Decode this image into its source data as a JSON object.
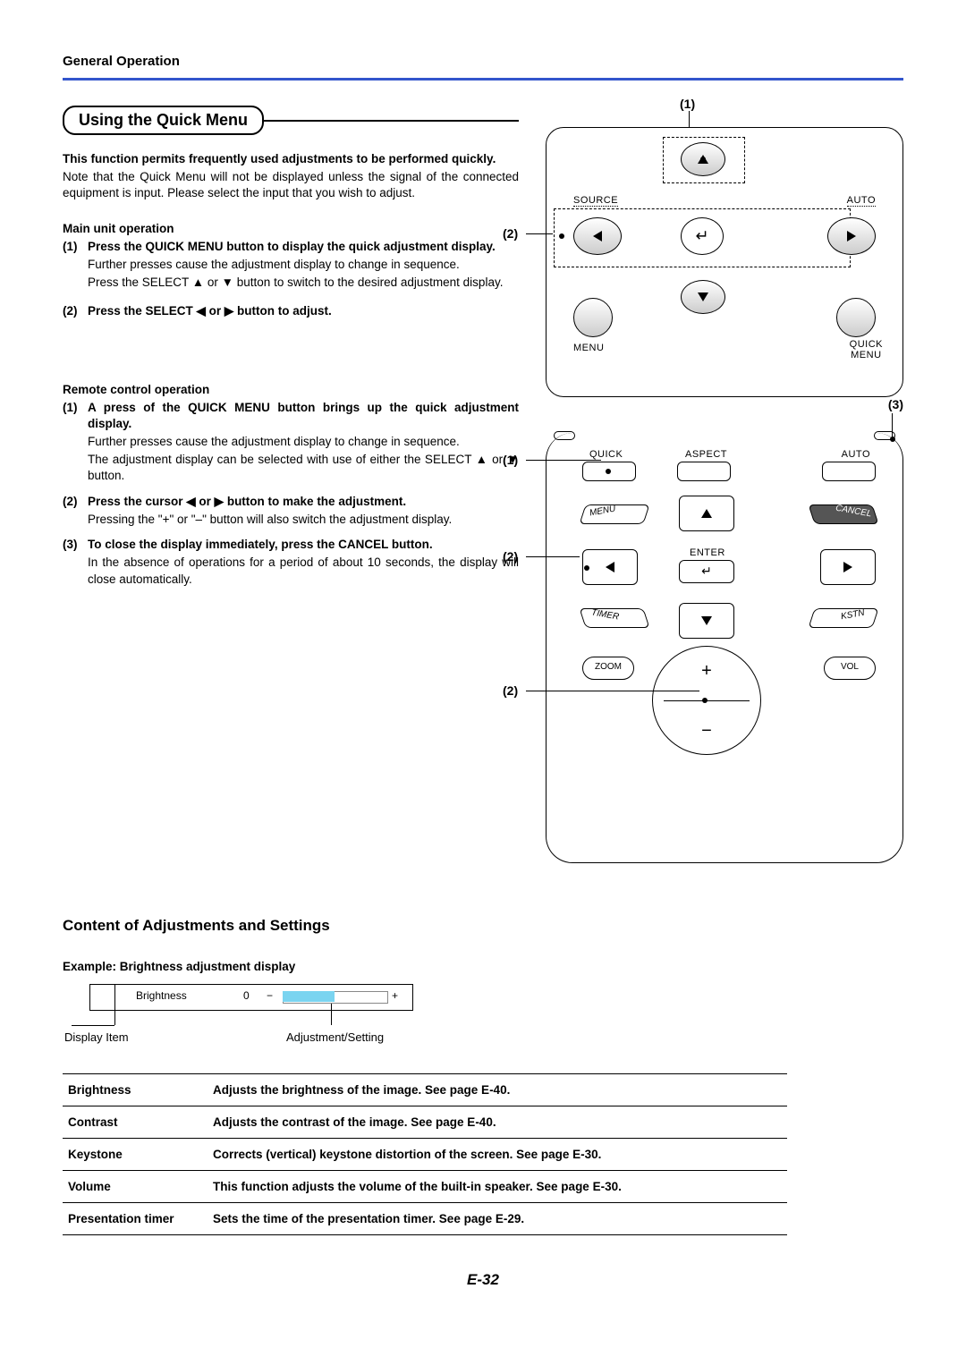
{
  "header": {
    "section": "General Operation"
  },
  "section1": {
    "title": "Using the Quick Menu",
    "lead": "This function permits frequently used adjustments to be performed quickly.",
    "note": "Note that the Quick Menu will not be displayed unless the signal of the connected equipment is input. Please select the input that you wish to adjust.",
    "main_head": "Main unit operation",
    "main_items": [
      {
        "num": "(1)",
        "bold": "Press the QUICK MENU button to display the quick adjustment display.",
        "rest1": "Further presses cause the adjustment display to change in sequence.",
        "rest2": "Press the SELECT ▲ or ▼ button to switch to the desired adjustment display."
      },
      {
        "num": "(2)",
        "bold": "Press the SELECT ◀ or ▶ button to adjust.",
        "rest1": "",
        "rest2": ""
      }
    ],
    "remote_head": "Remote control operation",
    "remote_items": [
      {
        "num": "(1)",
        "bold": "A press of the QUICK MENU button brings up the quick adjustment display.",
        "rest1": "Further presses cause the adjustment display to change in sequence.",
        "rest2": "The adjustment display can be selected with use of either the SELECT ▲ or ▼ button."
      },
      {
        "num": "(2)",
        "bold": "Press the cursor ◀ or ▶ button to make the adjustment.",
        "rest1": "Pressing the \"+\" or \"–\" button will also switch the adjustment display.",
        "rest2": ""
      },
      {
        "num": "(3)",
        "bold": "To close the display immediately, press the CANCEL button.",
        "rest1": "In the absence of operations for a period of about 10 seconds, the display will close automatically.",
        "rest2": ""
      }
    ]
  },
  "main_unit_labels": {
    "source": "SOURCE",
    "auto": "AUTO",
    "menu": "MENU",
    "quick_menu_top": "QUICK",
    "quick_menu_bottom": "MENU",
    "call1": "(1)",
    "call2": "(2)"
  },
  "remote_labels": {
    "quick": "QUICK",
    "aspect": "ASPECT",
    "auto": "AUTO",
    "menu": "MENU",
    "cancel": "CANCEL",
    "timer": "TIMER",
    "kstn": "KSTN",
    "enter": "ENTER",
    "enter_sym": "↵",
    "zoom": "ZOOM",
    "vol": "VOL",
    "call1": "(1)",
    "call2a": "(2)",
    "call2b": "(2)",
    "call3": "(3)"
  },
  "content": {
    "title": "Content of Adjustments and Settings",
    "example": "Example: Brightness adjustment display",
    "brightness_label": "Brightness",
    "zero": "0",
    "minus": "−",
    "plus": "+",
    "display_item": "Display Item",
    "adj_setting": "Adjustment/Setting",
    "table": [
      {
        "name": "Brightness",
        "desc": "Adjusts the brightness of the image. See page E-40."
      },
      {
        "name": "Contrast",
        "desc": "Adjusts the contrast of the image. See page E-40."
      },
      {
        "name": "Keystone",
        "desc": "Corrects (vertical) keystone distortion of the screen.  See page E-30."
      },
      {
        "name": "Volume",
        "desc": "This function adjusts the volume of the built-in speaker. See page E-30."
      },
      {
        "name": "Presentation timer",
        "desc": "Sets the time of the presentation timer.  See page E-29."
      }
    ]
  },
  "page": "E-32"
}
